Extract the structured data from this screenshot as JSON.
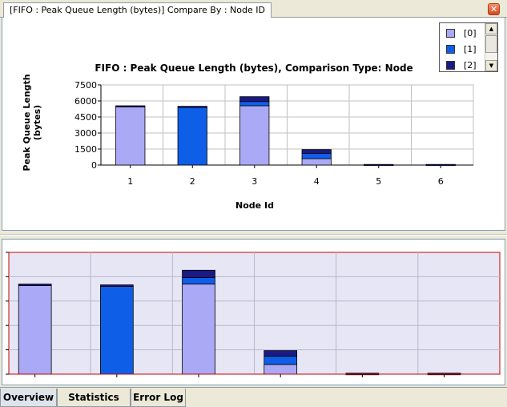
{
  "window": {
    "tab_title": "[FIFO :  Peak Queue Length (bytes)] Compare By : Node ID",
    "close_glyph": "✕"
  },
  "legend": {
    "items": [
      {
        "label": "[0]",
        "color": "#a9a9f5"
      },
      {
        "label": "[1]",
        "color": "#0f5ee8"
      },
      {
        "label": "[2]",
        "color": "#1a1a86"
      }
    ]
  },
  "chart_data": {
    "type": "bar",
    "stacked": true,
    "title": "FIFO :  Peak Queue Length (bytes), Comparison Type: Node",
    "xlabel": "Node Id",
    "ylabel": "Peak Queue Length (bytes)",
    "ylabel_lines": [
      "Peak Queue Length",
      "(bytes)"
    ],
    "ylim": [
      0,
      7500
    ],
    "yticks": [
      "7500",
      "6000",
      "4500",
      "3000",
      "1500",
      "0"
    ],
    "ytick_values": [
      7500,
      6000,
      4500,
      3000,
      1500,
      0
    ],
    "categories": [
      "1",
      "2",
      "3",
      "4",
      "5",
      "6"
    ],
    "series": [
      {
        "name": "[0]",
        "color": "#a9a9f5",
        "values": [
          5450,
          0,
          5550,
          600,
          0,
          0
        ]
      },
      {
        "name": "[1]",
        "color": "#0f5ee8",
        "values": [
          0,
          5400,
          400,
          500,
          0,
          0
        ]
      },
      {
        "name": "[2]",
        "color": "#1a1a86",
        "values": [
          100,
          100,
          450,
          350,
          60,
          60
        ]
      }
    ],
    "grid": true,
    "legend_position": "top-right"
  },
  "overview": {
    "plot_bg": "#e6e6f4",
    "border_color": "#c80000"
  },
  "bottom_tabs": [
    {
      "label": "Overview",
      "active": true
    },
    {
      "label": "Statistics File",
      "active": false
    },
    {
      "label": "Error Log",
      "active": false
    }
  ],
  "icons": {
    "scroll_up": "▲",
    "scroll_down": "▼"
  }
}
